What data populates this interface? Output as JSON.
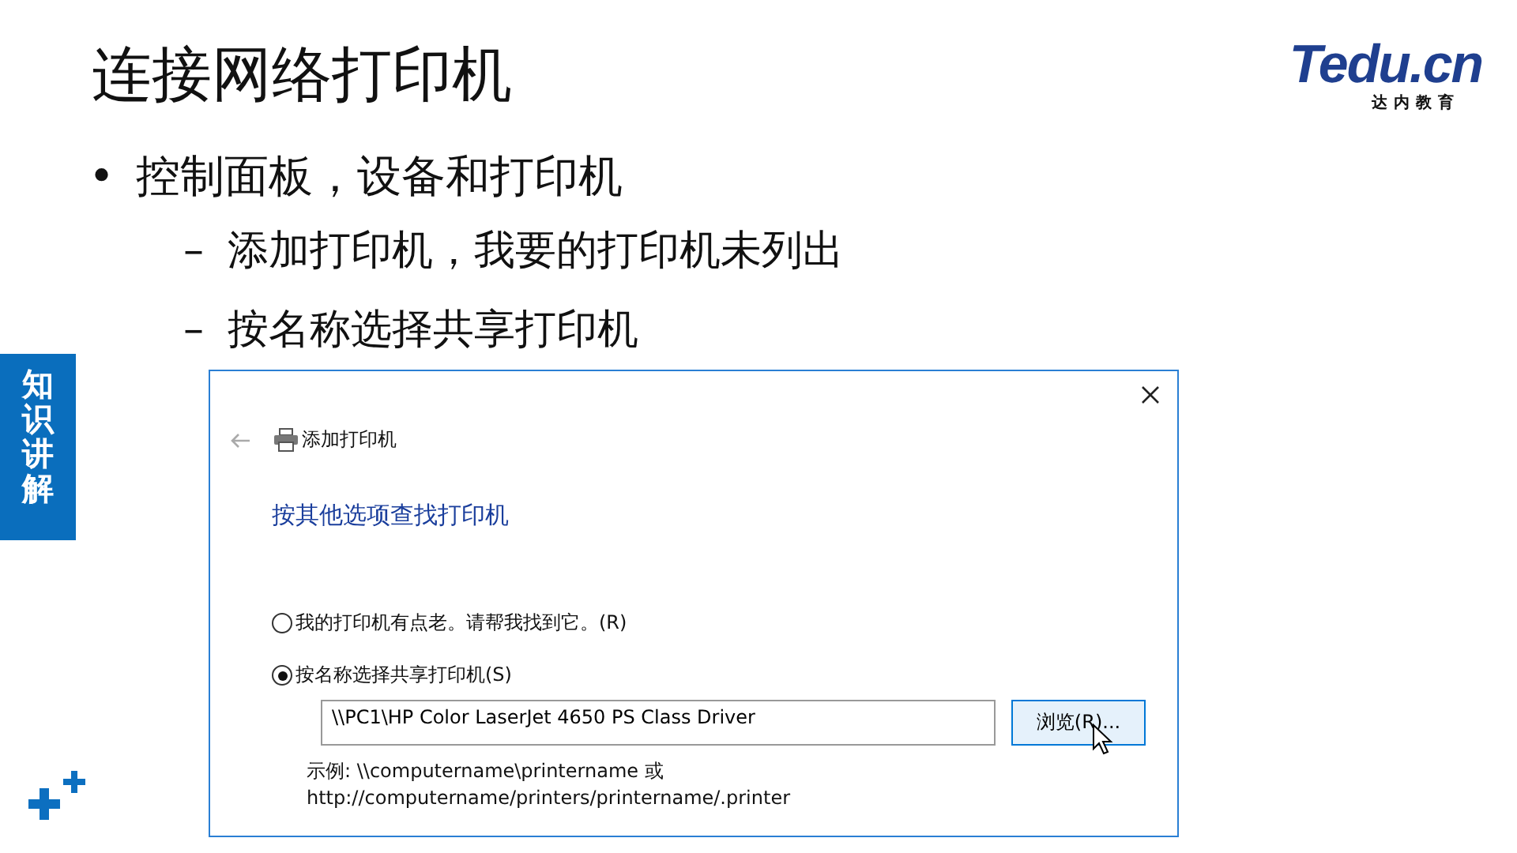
{
  "title": "连接网络打印机",
  "logo": {
    "wordmark": "Tedu.cn",
    "tagline": "达内教育"
  },
  "side_tab": "知识讲解",
  "bullets": [
    {
      "marker": "•",
      "text": "控制面板，设备和打印机",
      "children": [
        {
          "marker": "–",
          "text": "添加打印机，我要的打印机未列出"
        },
        {
          "marker": "–",
          "text": "按名称选择共享打印机"
        }
      ]
    }
  ],
  "dialog": {
    "title": "添加打印机",
    "heading": "按其他选项查找打印机",
    "options": [
      {
        "label": "我的打印机有点老。请帮我找到它。(R)",
        "selected": false
      },
      {
        "label": "按名称选择共享打印机(S)",
        "selected": true
      }
    ],
    "path_field": {
      "value": "\\\\PC1\\HP Color LaserJet 4650 PS Class Driver"
    },
    "browse_button": "浏览(R)...",
    "example_lines": [
      "示例: \\\\computername\\printername 或",
      "http://computername/printers/printername/.printer"
    ]
  }
}
